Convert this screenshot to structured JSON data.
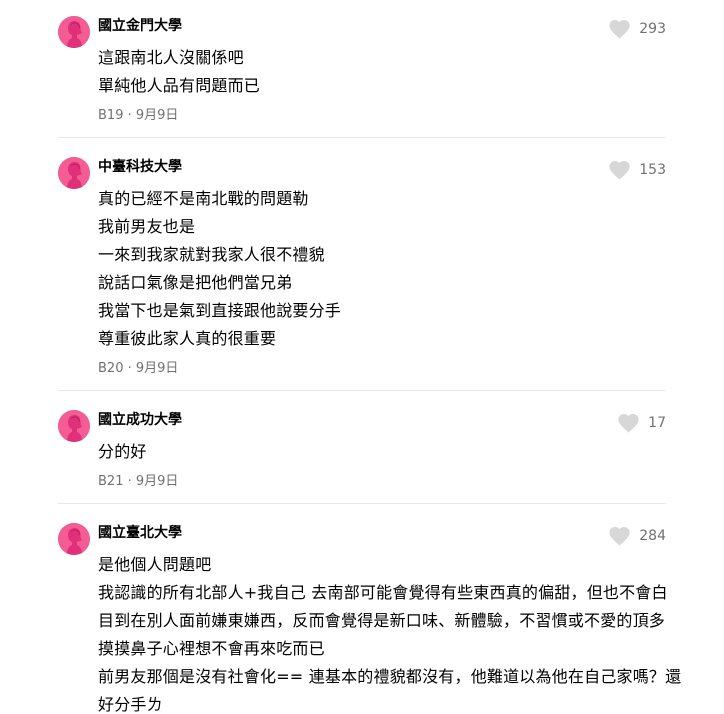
{
  "comments": [
    {
      "school": "國立金門大學",
      "likes": "293",
      "lines": [
        "這跟南北人沒關係吧",
        "單純他人品有問題而已"
      ],
      "floor": "B19",
      "date": "9月9日"
    },
    {
      "school": "中臺科技大學",
      "likes": "153",
      "lines": [
        "真的已經不是南北戰的問題勒",
        "我前男友也是",
        "一來到我家就對我家人很不禮貌",
        "說話口氣像是把他們當兄弟",
        "我當下也是氣到直接跟他說要分手",
        "尊重彼此家人真的很重要"
      ],
      "floor": "B20",
      "date": "9月9日"
    },
    {
      "school": "國立成功大學",
      "likes": "17",
      "lines": [
        "分的好"
      ],
      "floor": "B21",
      "date": "9月9日"
    },
    {
      "school": "國立臺北大學",
      "likes": "284",
      "lines": [
        "是他個人問題吧",
        "我認識的所有北部人+我自己 去南部可能會覺得有些東西真的偏甜，但也不會白",
        "目到在別人面前嫌東嫌西，反而會覺得是新口味、新體驗，不習慣或不愛的頂多",
        "摸摸鼻子心裡想不會再來吃而已",
        "前男友那個是沒有社會化== 連基本的禮貌都沒有，他難道以為他在自己家嗎？還",
        "好分手ㄌ"
      ],
      "floor": "",
      "date": ""
    }
  ],
  "meta_separator": " · ",
  "colors": {
    "avatar": "#f45c94",
    "heart": "#d7d7d7",
    "muted": "#717171",
    "divider": "#e9e9e9"
  },
  "icons": {
    "avatar": "female-avatar-icon",
    "like": "heart-icon"
  }
}
